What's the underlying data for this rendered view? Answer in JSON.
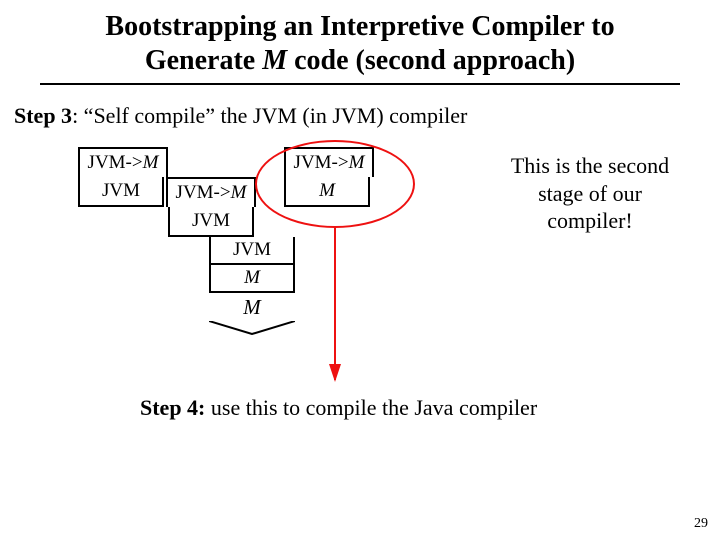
{
  "title_line1_a": "Bootstrapping an Interpretive Compiler to",
  "title_line2_a": "Generate ",
  "title_line2_ital": "M",
  "title_line2_b": " code (second approach)",
  "step3_label": "Step 3",
  "step3_text": ": “Self compile” the JVM (in JVM) compiler",
  "t_left_src": "JVM->",
  "t_left_src_tgt": "M",
  "t_left_impl": "JVM",
  "t_mid_src": "JVM->",
  "t_mid_src_tgt": "M",
  "t_mid_impl": "JVM",
  "stack_jvm": "JVM",
  "stack_m1": "M",
  "stack_m2": "M",
  "t_right_src": "JVM->",
  "t_right_src_tgt": "M",
  "t_right_impl": "M",
  "note_l1": "This is the second",
  "note_l2": "stage of our",
  "note_l3": "compiler!",
  "step4_label": "Step 4:",
  "step4_text": " use this to compile the Java compiler",
  "page_number": "29"
}
